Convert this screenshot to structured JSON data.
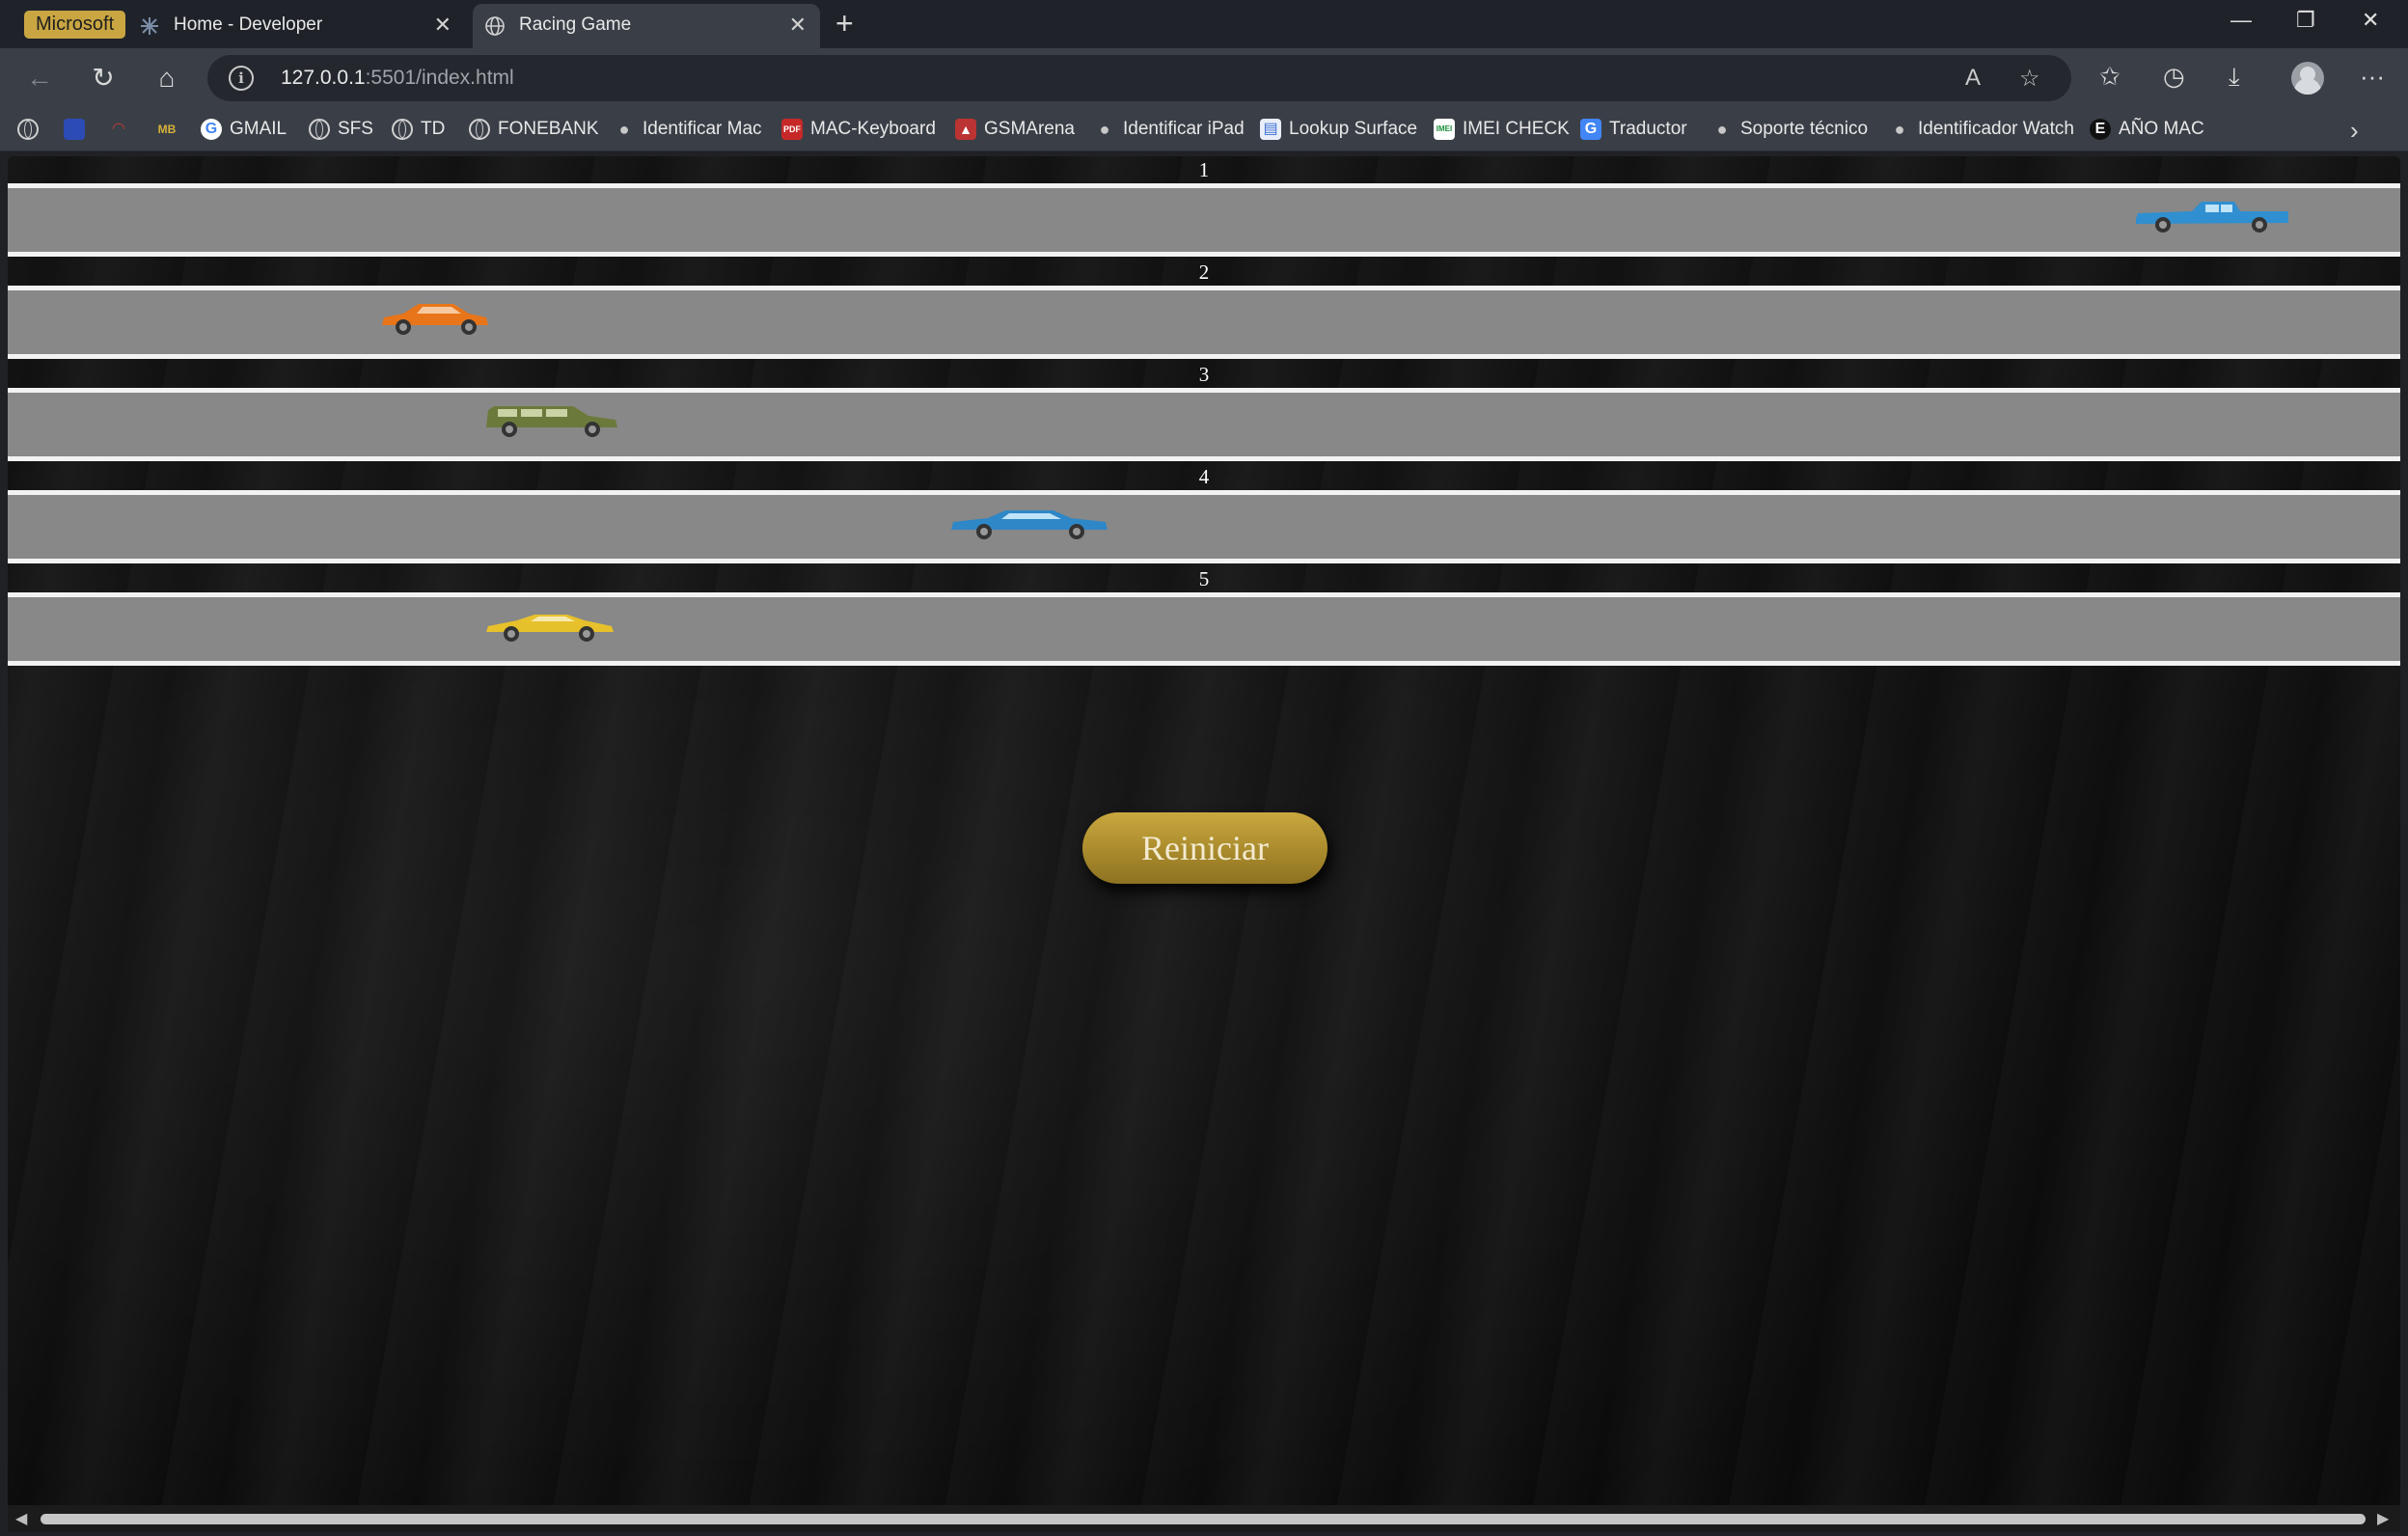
{
  "browser": {
    "profile_label": "Microsoft",
    "tabs": [
      {
        "title": "Home - Developer",
        "active": false
      },
      {
        "title": "Racing Game",
        "active": true
      }
    ],
    "url_host": "127.0.0.1",
    "url_rest": ":5501/index.html",
    "bookmarks": [
      {
        "label": "",
        "icon": "globe-icon"
      },
      {
        "label": "",
        "icon": "blue-app-icon"
      },
      {
        "label": "",
        "icon": "gauge-icon"
      },
      {
        "label": "",
        "icon": "mb-icon"
      },
      {
        "label": "GMAIL",
        "icon": "google-icon"
      },
      {
        "label": "SFS",
        "icon": "globe-icon"
      },
      {
        "label": "TD",
        "icon": "globe-icon"
      },
      {
        "label": "FONEBANK",
        "icon": "globe-icon"
      },
      {
        "label": "Identificar Mac",
        "icon": "apple-icon"
      },
      {
        "label": "MAC-Keyboard",
        "icon": "pdf-icon"
      },
      {
        "label": "GSMArena",
        "icon": "gsmarena-icon"
      },
      {
        "label": "Identificar iPad",
        "icon": "apple-icon"
      },
      {
        "label": "Lookup Surface",
        "icon": "document-icon"
      },
      {
        "label": "IMEI CHECK",
        "icon": "imei-icon"
      },
      {
        "label": "Traductor",
        "icon": "translate-icon"
      },
      {
        "label": "Soporte técnico",
        "icon": "apple-icon"
      },
      {
        "label": "Identificador Watch",
        "icon": "apple-icon"
      },
      {
        "label": "AÑO MAC",
        "icon": "everymac-icon"
      }
    ]
  },
  "game": {
    "lanes": [
      {
        "number": "1",
        "car": "blue pickup truck",
        "color": "#2f8fd0"
      },
      {
        "number": "2",
        "car": "orange hatchback",
        "color": "#e8751a"
      },
      {
        "number": "3",
        "car": "olive green SUV",
        "color": "#6b7a3a"
      },
      {
        "number": "4",
        "car": "blue sedan",
        "color": "#2e87c7"
      },
      {
        "number": "5",
        "car": "yellow sports car",
        "color": "#e7c12b"
      }
    ],
    "restart_label": "Reiniciar"
  }
}
